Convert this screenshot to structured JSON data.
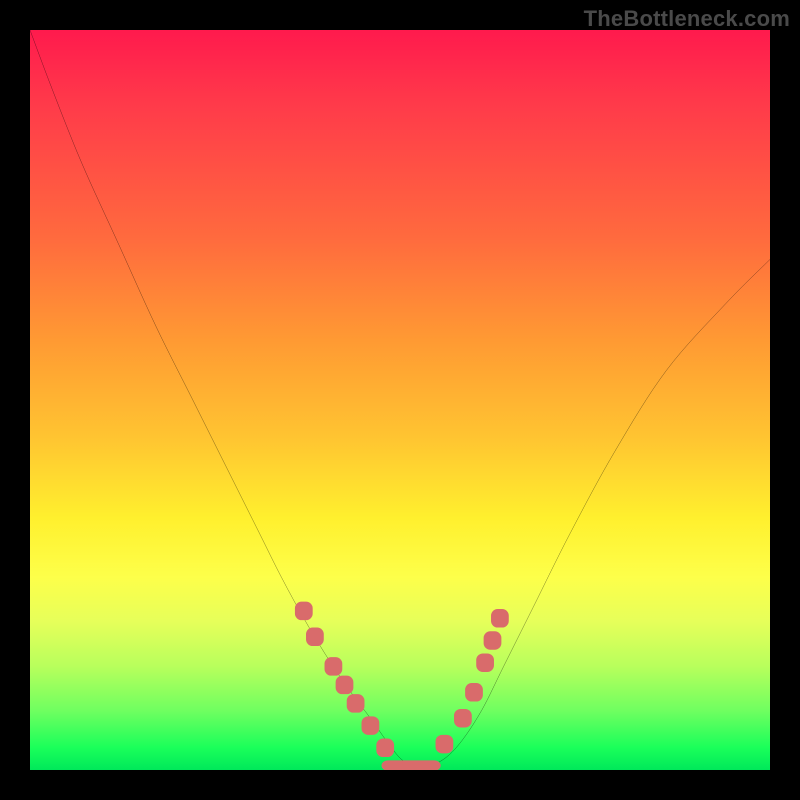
{
  "watermark": "TheBottleneck.com",
  "chart_data": {
    "type": "line",
    "title": "",
    "xlabel": "",
    "ylabel": "",
    "xlim": [
      0,
      100
    ],
    "ylim": [
      0,
      100
    ],
    "grid": false,
    "legend": false,
    "note": "Axis values are normalized 0–100 estimated from pixel position (no tick labels are rendered). y represents bottleneck severity: ~0 = green/optimal, ~100 = red/severe.",
    "series": [
      {
        "name": "bottleneck-curve",
        "color": "#000000",
        "x": [
          0,
          3,
          7,
          12,
          17,
          22,
          27,
          31,
          34,
          37,
          40,
          43,
          46,
          48.5,
          50.5,
          53,
          55.5,
          58,
          61,
          64,
          68,
          73,
          79,
          86,
          94,
          100
        ],
        "y": [
          100,
          92,
          82,
          71,
          60,
          50,
          40,
          32,
          26,
          20.5,
          15.5,
          11,
          7,
          3.5,
          1.2,
          0.5,
          1.2,
          3.5,
          8,
          14,
          22,
          32,
          43,
          54,
          63,
          69
        ]
      }
    ],
    "markers": [
      {
        "name": "left-cluster",
        "color": "#d96b6b",
        "shape": "rounded-rect",
        "points": [
          {
            "x": 37.0,
            "y": 21.5
          },
          {
            "x": 38.5,
            "y": 18.0
          },
          {
            "x": 41.0,
            "y": 14.0
          },
          {
            "x": 42.5,
            "y": 11.5
          },
          {
            "x": 44.0,
            "y": 9.0
          },
          {
            "x": 46.0,
            "y": 6.0
          },
          {
            "x": 48.0,
            "y": 3.0
          }
        ]
      },
      {
        "name": "bottom-band",
        "color": "#d96b6b",
        "shape": "wide-rounded-rect",
        "points": [
          {
            "x": 51.5,
            "y": 0.6
          }
        ]
      },
      {
        "name": "right-cluster",
        "color": "#d96b6b",
        "shape": "rounded-rect",
        "points": [
          {
            "x": 56.0,
            "y": 3.5
          },
          {
            "x": 58.5,
            "y": 7.0
          },
          {
            "x": 60.0,
            "y": 10.5
          },
          {
            "x": 61.5,
            "y": 14.5
          },
          {
            "x": 62.5,
            "y": 17.5
          },
          {
            "x": 63.5,
            "y": 20.5
          }
        ]
      }
    ],
    "background_gradient": {
      "direction": "vertical",
      "stops": [
        {
          "pos": 0.0,
          "color": "#ff1a4d"
        },
        {
          "pos": 0.28,
          "color": "#ff6a3e"
        },
        {
          "pos": 0.55,
          "color": "#ffc431"
        },
        {
          "pos": 0.74,
          "color": "#fdff4a"
        },
        {
          "pos": 0.92,
          "color": "#6fff60"
        },
        {
          "pos": 1.0,
          "color": "#00e85a"
        }
      ]
    }
  }
}
